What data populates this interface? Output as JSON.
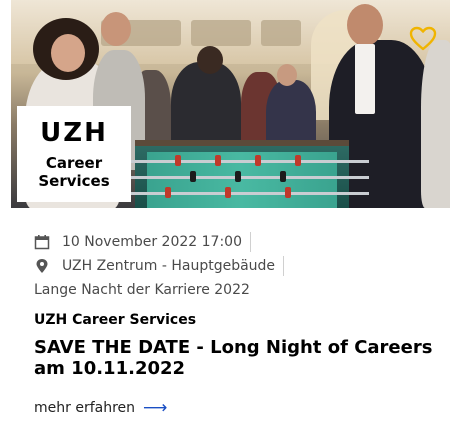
{
  "hero": {
    "logo": {
      "main": "UZH",
      "line1": "Career",
      "line2": "Services"
    },
    "favorite_icon": "heart-outline-icon",
    "favorite_color": "#f0b400"
  },
  "event": {
    "date": "10 November 2022 17:00",
    "date_icon": "calendar-icon",
    "location": "UZH Zentrum - Hauptgebäude",
    "location_icon": "map-pin-icon",
    "category": "Lange Nacht der Karriere 2022",
    "organizer": "UZH Career Services",
    "title": "SAVE THE DATE - Long Night of Careers am 10.11.2022",
    "more_label": "mehr erfahren",
    "more_icon": "arrow-right-icon",
    "accent_color": "#1a4fc4"
  }
}
